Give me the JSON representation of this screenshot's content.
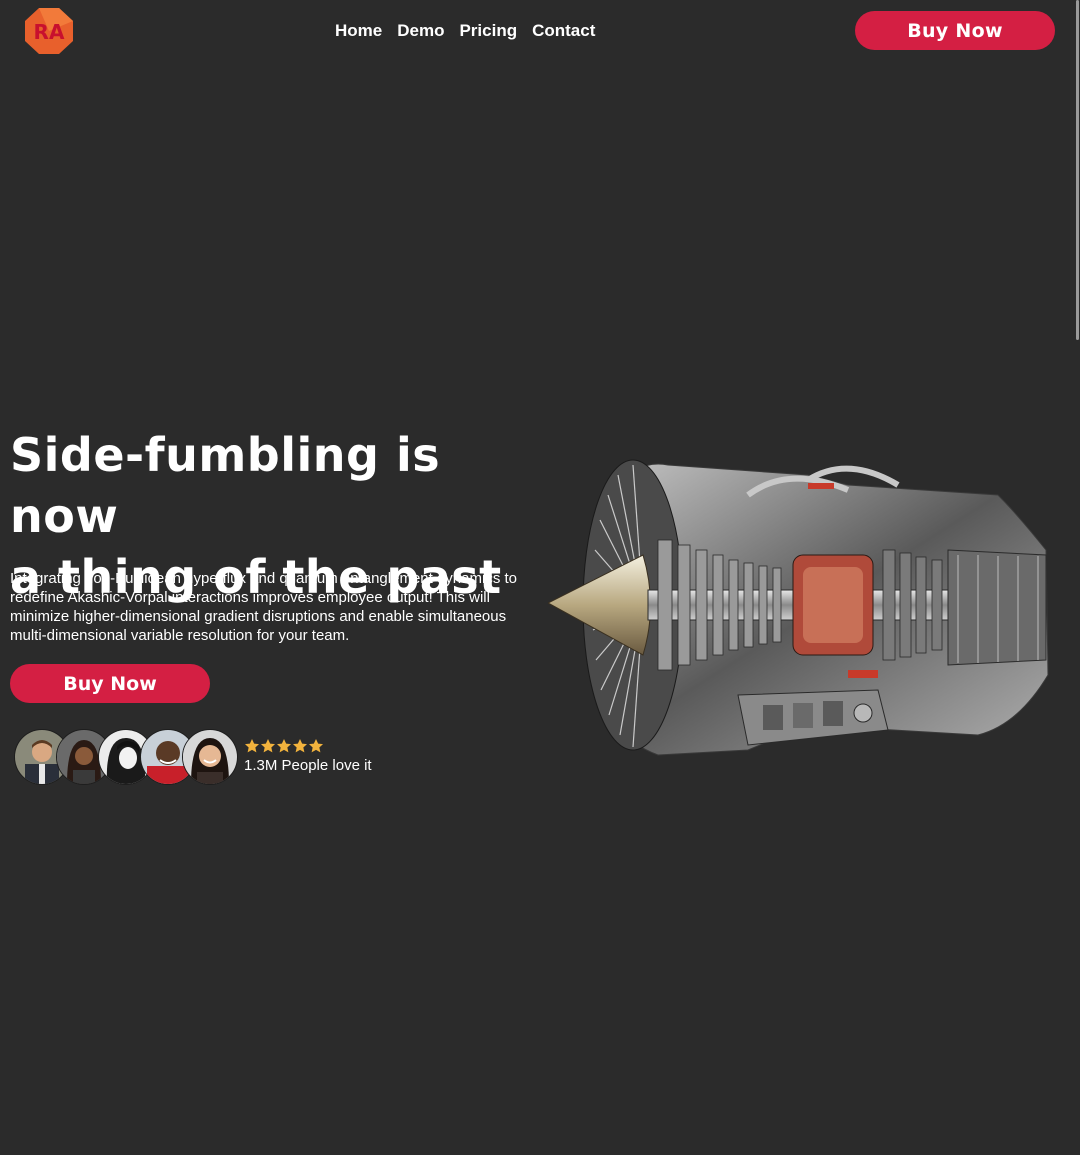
{
  "header": {
    "logo_text": "RA",
    "nav": [
      {
        "label": "Home"
      },
      {
        "label": "Demo"
      },
      {
        "label": "Pricing"
      },
      {
        "label": "Contact"
      }
    ],
    "buy_label": "Buy Now"
  },
  "hero": {
    "title_line1": "Side-fumbling is now",
    "title_line2": "a thing of the past",
    "description": "Integrating non-Euclidean hyperflux and quantum entanglement dynamics to redefine Akashic-Vorpal interactions improves employee output! This will minimize higher-dimensional gradient disruptions and enable simultaneous multi-dimensional variable resolution for your team.",
    "buy_label": "Buy Now"
  },
  "social_proof": {
    "avatar_count": 5,
    "rating_stars": 5,
    "love_text": "1.3M People love it"
  },
  "colors": {
    "background": "#2b2b2b",
    "accent": "#d41f43",
    "logo_orange": "#e8602c",
    "star": "#f2b33d"
  },
  "icons": {
    "logo": "ra-logo-icon",
    "star": "star-icon",
    "hero_image": "jet-engine-cutaway"
  }
}
